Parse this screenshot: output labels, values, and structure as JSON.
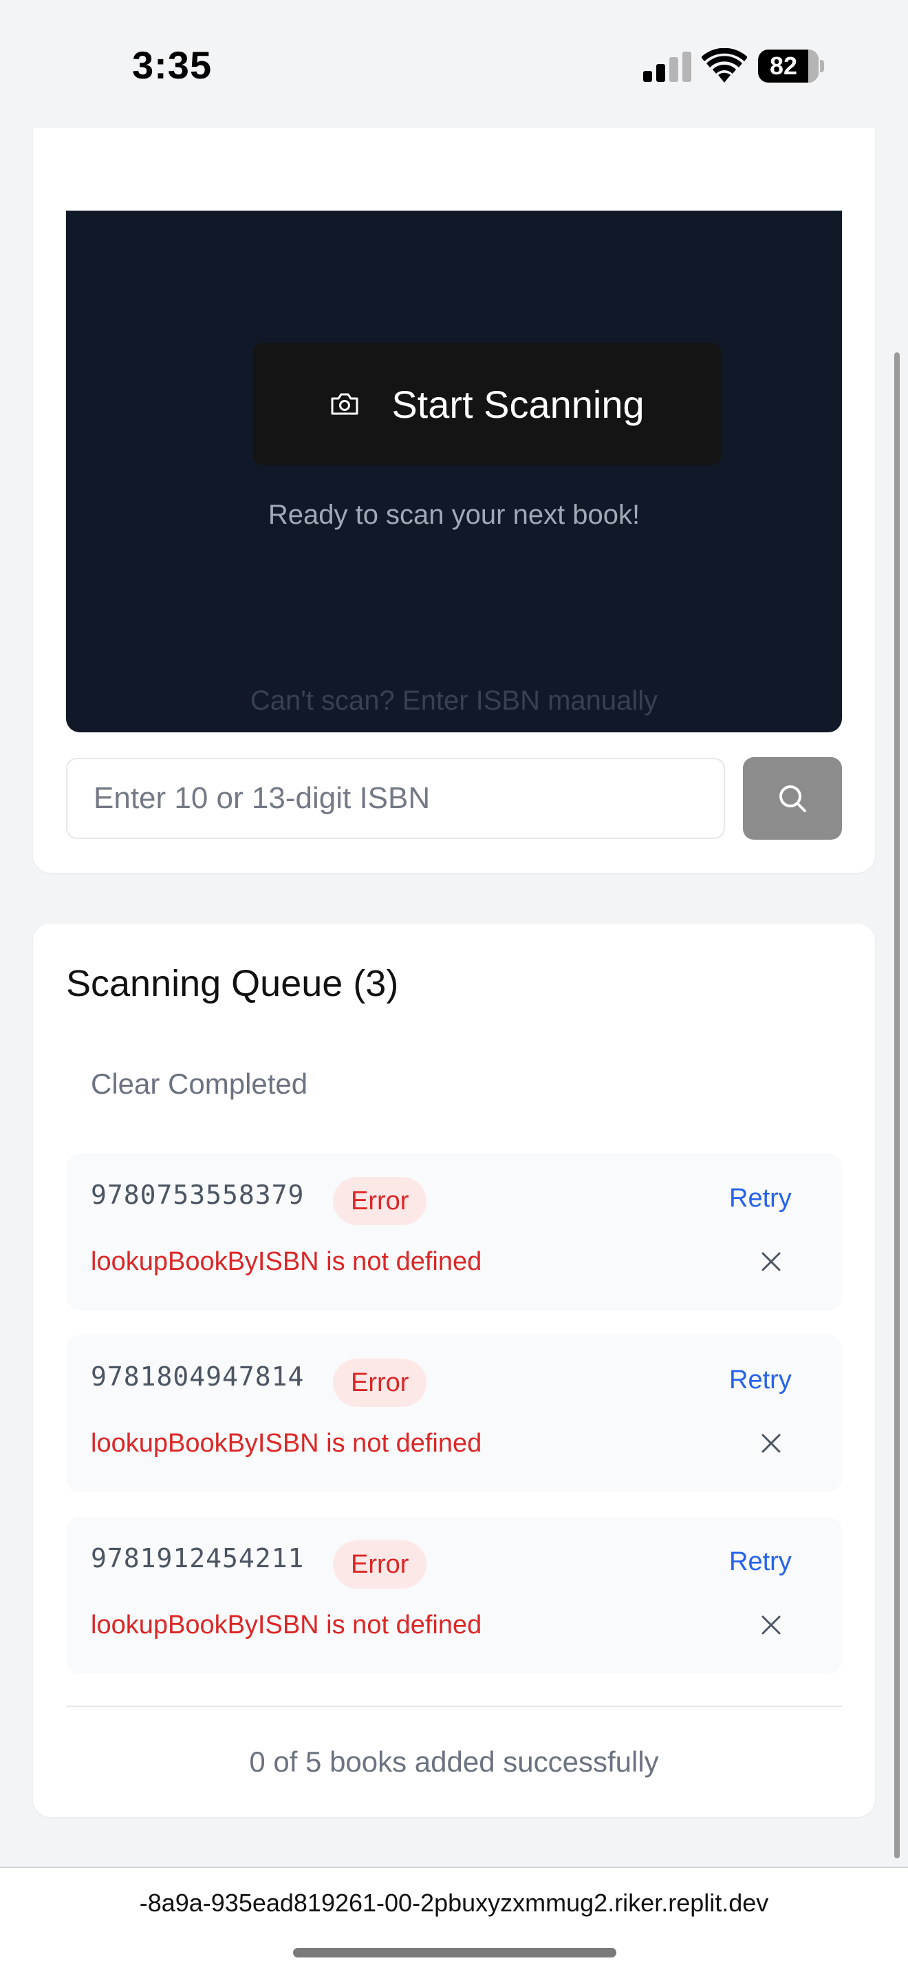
{
  "status_bar": {
    "time": "3:35",
    "battery_level": "82",
    "icons": [
      "signal-icon",
      "wifi-icon",
      "battery-icon"
    ]
  },
  "scanner": {
    "start_button_label": "Start Scanning",
    "status_text": "Ready to scan your next book!",
    "manual_label": "Can't scan? Enter ISBN manually",
    "isbn_placeholder": "Enter 10 or 13-digit ISBN",
    "isbn_value": ""
  },
  "queue": {
    "title": "Scanning Queue (3)",
    "clear_label": "Clear Completed",
    "items": [
      {
        "isbn": "9780753558379",
        "status": "Error",
        "message": "lookupBookByISBN is not defined",
        "retry_label": "Retry"
      },
      {
        "isbn": "9781804947814",
        "status": "Error",
        "message": "lookupBookByISBN is not defined",
        "retry_label": "Retry"
      },
      {
        "isbn": "9781912454211",
        "status": "Error",
        "message": "lookupBookByISBN is not defined",
        "retry_label": "Retry"
      }
    ],
    "summary": "0 of 5 books added successfully"
  },
  "browser": {
    "url": "-8a9a-935ead819261-00-2pbuxyzxmmug2.riker.replit.dev"
  },
  "colors": {
    "scanner_bg": "#111827",
    "error": "#dc2626",
    "error_badge_bg": "#fde8e8",
    "link": "#2563eb",
    "search_button": "#8c8c8c"
  }
}
